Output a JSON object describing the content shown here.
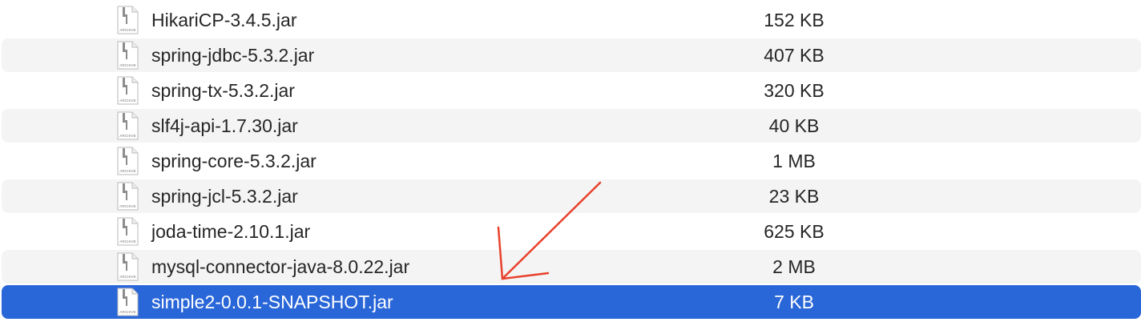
{
  "files": [
    {
      "name": "HikariCP-3.4.5.jar",
      "size": "152 KB",
      "selected": false,
      "icon": "archive-file-icon",
      "icon_label": "ARCHIVE"
    },
    {
      "name": "spring-jdbc-5.3.2.jar",
      "size": "407 KB",
      "selected": false,
      "icon": "archive-file-icon",
      "icon_label": "ARCHIVE"
    },
    {
      "name": "spring-tx-5.3.2.jar",
      "size": "320 KB",
      "selected": false,
      "icon": "archive-file-icon",
      "icon_label": "ARCHIVE"
    },
    {
      "name": "slf4j-api-1.7.30.jar",
      "size": "40 KB",
      "selected": false,
      "icon": "archive-file-icon",
      "icon_label": "ARCHIVE"
    },
    {
      "name": "spring-core-5.3.2.jar",
      "size": "1 MB",
      "selected": false,
      "icon": "archive-file-icon",
      "icon_label": "ARCHIVE"
    },
    {
      "name": "spring-jcl-5.3.2.jar",
      "size": "23 KB",
      "selected": false,
      "icon": "archive-file-icon",
      "icon_label": "ARCHIVE"
    },
    {
      "name": "joda-time-2.10.1.jar",
      "size": "625 KB",
      "selected": false,
      "icon": "archive-file-icon",
      "icon_label": "ARCHIVE"
    },
    {
      "name": "mysql-connector-java-8.0.22.jar",
      "size": "2 MB",
      "selected": false,
      "icon": "archive-file-icon",
      "icon_label": "ARCHIVE"
    },
    {
      "name": "simple2-0.0.1-SNAPSHOT.jar",
      "size": "7 KB",
      "selected": true,
      "icon": "archive-file-icon",
      "icon_label": "ARCHIVE"
    }
  ],
  "colors": {
    "selection": "#2966d8",
    "stripe": "#f4f4f4",
    "text": "#262626",
    "annotation": "#e8412c"
  }
}
